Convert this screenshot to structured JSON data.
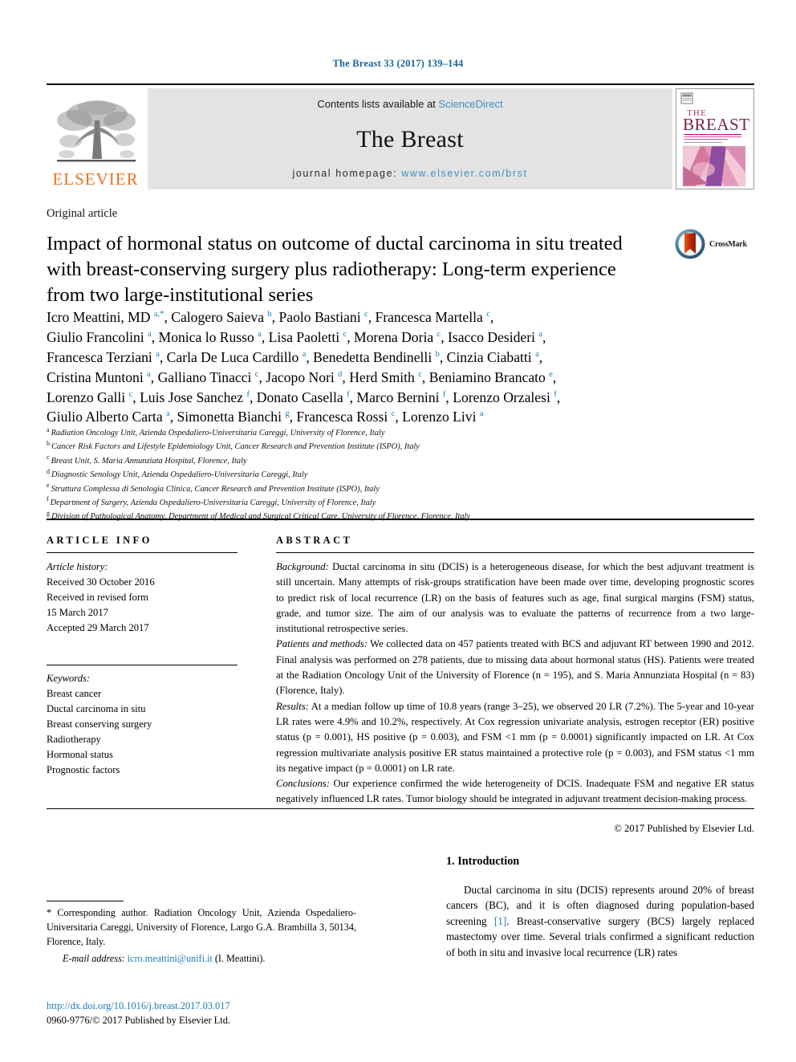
{
  "running_head": "The Breast 33 (2017) 139–144",
  "masthead": {
    "publisher_name": "ELSEVIER",
    "contents_prefix": "Contents lists available at ",
    "contents_link": "ScienceDirect",
    "journal_title": "The Breast",
    "homepage_prefix": "journal homepage: ",
    "homepage_url": "www.elsevier.com/brst",
    "cover_title_the": "THE",
    "cover_title_main": "BREAST"
  },
  "article_type": "Original article",
  "title": "Impact of hormonal status on outcome of ductal carcinoma in situ treated with breast-conserving surgery plus radiotherapy: Long-term experience from two large-institutional series",
  "crossmark_label": "CrossMark",
  "authors_lines": [
    "Icro Meattini, MD a,*, Calogero Saieva b, Paolo Bastiani c, Francesca Martella c,",
    "Giulio Francolini a, Monica lo Russo a, Lisa Paoletti c, Morena Doria c, Isacco Desideri a,",
    "Francesca Terziani a, Carla De Luca Cardillo a, Benedetta Bendinelli b, Cinzia Ciabatti a,",
    "Cristina Muntoni a, Galliano Tinacci c, Jacopo Nori d, Herd Smith c, Beniamino Brancato e,",
    "Lorenzo Galli c, Luis Jose Sanchez f, Donato Casella f, Marco Bernini f, Lorenzo Orzalesi f,",
    "Giulio Alberto Carta a, Simonetta Bianchi g, Francesca Rossi c, Lorenzo Livi a"
  ],
  "affiliations": [
    {
      "mark": "a",
      "text": "Radiation Oncology Unit, Azienda Ospedaliero-Universitaria Careggi, University of Florence, Italy"
    },
    {
      "mark": "b",
      "text": "Cancer Risk Factors and Lifestyle Epidemiology Unit, Cancer Research and Prevention Institute (ISPO), Italy"
    },
    {
      "mark": "c",
      "text": "Breast Unit, S. Maria Annunziata Hospital, Florence, Italy"
    },
    {
      "mark": "d",
      "text": "Diagnostic Senology Unit, Azienda Ospedaliero-Universitaria Careggi, Italy"
    },
    {
      "mark": "e",
      "text": "Struttura Complessa di Senologia Clinica, Cancer Research and Prevention Institute (ISPO), Italy"
    },
    {
      "mark": "f",
      "text": "Department of Surgery, Azienda Ospedaliero-Universitaria Careggi, University of Florence, Italy"
    },
    {
      "mark": "g",
      "text": "Division of Pathological Anatomy, Department of Medical and Surgical Critical Care, University of Florence, Florence, Italy"
    }
  ],
  "article_info": {
    "heading": "ARTICLE INFO",
    "history_label": "Article history:",
    "history_lines": [
      "Received 30 October 2016",
      "Received in revised form",
      "15 March 2017",
      "Accepted 29 March 2017"
    ],
    "keywords_label": "Keywords:",
    "keywords": [
      "Breast cancer",
      "Ductal carcinoma in situ",
      "Breast conserving surgery",
      "Radiotherapy",
      "Hormonal status",
      "Prognostic factors"
    ]
  },
  "abstract": {
    "heading": "ABSTRACT",
    "sections": [
      {
        "label": "Background:",
        "text": " Ductal carcinoma in situ (DCIS) is a heterogeneous disease, for which the best adjuvant treatment is still uncertain. Many attempts of risk-groups stratification have been made over time, developing prognostic scores to predict risk of local recurrence (LR) on the basis of features such as age, final surgical margins (FSM) status, grade, and tumor size. The aim of our analysis was to evaluate the patterns of recurrence from a two large-institutional retrospective series."
      },
      {
        "label": "Patients and methods:",
        "text": " We collected data on 457 patients treated with BCS and adjuvant RT between 1990 and 2012. Final analysis was performed on 278 patients, due to missing data about hormonal status (HS). Patients were treated at the Radiation Oncology Unit of the University of Florence (n = 195), and S. Maria Annunziata Hospital (n = 83) (Florence, Italy)."
      },
      {
        "label": "Results:",
        "text": " At a median follow up time of 10.8 years (range 3–25), we observed 20 LR (7.2%). The 5-year and 10-year LR rates were 4.9% and 10.2%, respectively. At Cox regression univariate analysis, estrogen receptor (ER) positive status (p = 0.001), HS positive (p = 0.003), and FSM <1 mm (p = 0.0001) significantly impacted on LR. At Cox regression multivariate analysis positive ER status maintained a protective role (p = 0.003), and FSM status <1 mm its negative impact (p = 0.0001) on LR rate."
      },
      {
        "label": "Conclusions:",
        "text": " Our experience confirmed the wide heterogeneity of DCIS. Inadequate FSM and negative ER status negatively influenced LR rates. Tumor biology should be integrated in adjuvant treatment decision-making process."
      }
    ],
    "copyright": "© 2017 Published by Elsevier Ltd."
  },
  "introduction": {
    "heading": "1. Introduction",
    "text_before_ref": "Ductal carcinoma in situ (DCIS) represents around 20% of breast cancers (BC), and it is often diagnosed during population-based screening ",
    "reference": "[1]",
    "text_after_ref": ". Breast-conservative surgery (BCS) largely replaced mastectomy over time. Several trials confirmed a significant reduction of both in situ and invasive local recurrence (LR) rates"
  },
  "footnotes": {
    "corresponding": "* Corresponding author. Radiation Oncology Unit, Azienda Ospedaliero-Universitaria Careggi, University of Florence, Largo G.A. Brambilla 3, 50134, Florence, Italy.",
    "email_label": "E-mail address:",
    "email": "icro.meattini@unifi.it",
    "email_suffix": " (I. Meattini).",
    "doi": "http://dx.doi.org/10.1016/j.breast.2017.03.017",
    "issn_line": "0960-9776/© 2017 Published by Elsevier Ltd."
  },
  "colors": {
    "link": "#1a7db5",
    "sciencedirect": "#3d8fc4",
    "elsevier_orange": "#E87422",
    "band_gray": "#e3e3e3"
  }
}
